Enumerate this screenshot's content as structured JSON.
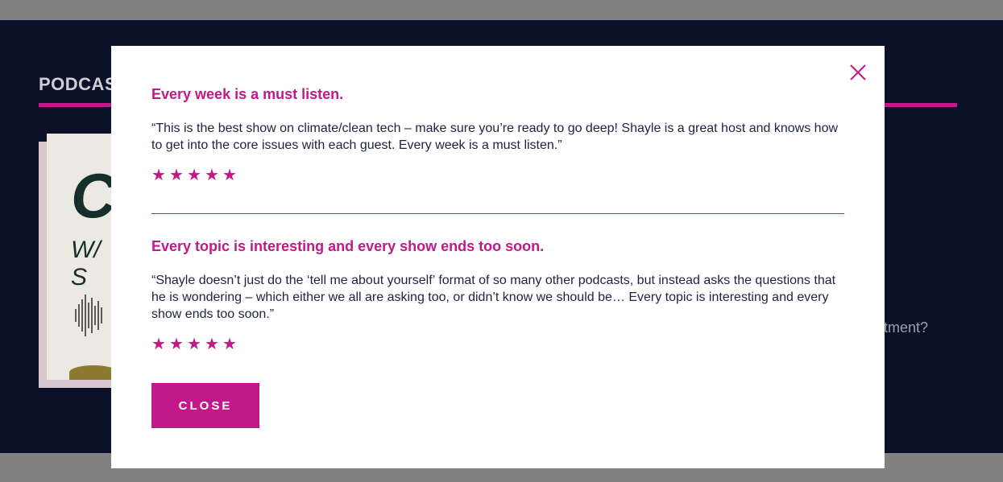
{
  "background": {
    "section_title": "PODCAS",
    "teaser_text": "tment?",
    "cover": {
      "big_letters": "CA",
      "sub": "W/ S"
    }
  },
  "colors": {
    "accent": "#c2188a",
    "page_bg": "#0a1128",
    "text": "#1c2440"
  },
  "modal": {
    "close_icon": "close-x-icon",
    "reviews": [
      {
        "title": "Every week is a must listen.",
        "quote": "“This is the best show on climate/clean tech – make sure you’re ready to go deep! Shayle is a great host and knows how to get into the core issues with each guest. Every week is a must listen.”",
        "rating": 5
      },
      {
        "title": "Every topic is interesting and every show ends too soon.",
        "quote": "“Shayle doesn’t just do the ‘tell me about yourself’ format of so many other podcasts, but instead asks the questions that he is wondering – which either we all are asking too, or didn’t know we should be… Every topic is interesting and every show ends too soon.”",
        "rating": 5
      }
    ],
    "close_label": "CLOSE"
  }
}
